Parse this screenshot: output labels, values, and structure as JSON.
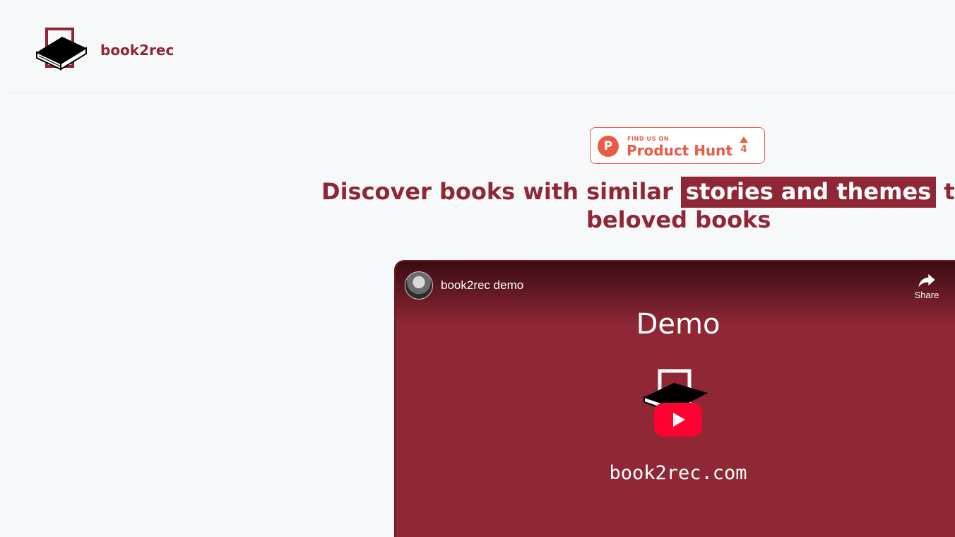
{
  "header": {
    "brand_name": "book2rec",
    "logo_icon": "book-logo-icon"
  },
  "product_hunt": {
    "small_label": "FIND US ON",
    "big_label": "Product Hunt",
    "icon_letter": "P",
    "upvote_count": "4",
    "accent_color": "#ea5b43"
  },
  "hero": {
    "headline_before": "Discover books with similar",
    "headline_highlight": "stories and themes",
    "headline_after": "to your",
    "headline_line2": "beloved books"
  },
  "video": {
    "title": "book2rec demo",
    "share_label": "Share",
    "demo_text": "Demo",
    "url_text": "book2rec.com",
    "background_color": "#8f2735",
    "play_color": "#ff0033"
  },
  "colors": {
    "brand": "#8f2735",
    "page_background": "#f7f8fa"
  }
}
